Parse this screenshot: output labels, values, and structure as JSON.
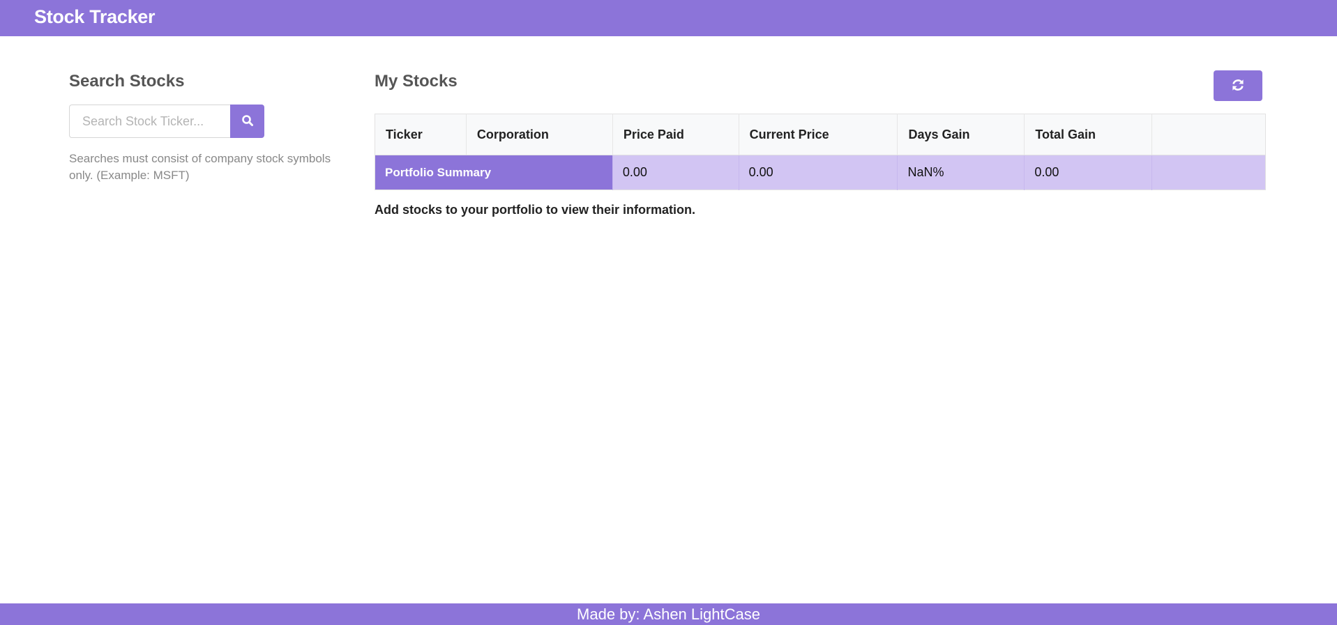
{
  "navbar": {
    "brand": "Stock Tracker"
  },
  "search": {
    "title": "Search Stocks",
    "placeholder": "Search Stock Ticker...",
    "button_icon": "search-icon",
    "help_text": "Searches must consist of company stock symbols only. (Example: MSFT)"
  },
  "portfolio": {
    "title": "My Stocks",
    "refresh_icon": "refresh-icon",
    "columns": [
      "Ticker",
      "Corporation",
      "Price Paid",
      "Current Price",
      "Days Gain",
      "Total Gain",
      ""
    ],
    "summary": {
      "label": "Portfolio Summary",
      "price_paid": "0.00",
      "current_price": "0.00",
      "days_gain": "NaN%",
      "total_gain": "0.00"
    },
    "empty_message": "Add stocks to your portfolio to view their information."
  },
  "footer": {
    "text": "Made by: Ashen LightCase"
  },
  "colors": {
    "accent": "#8c74d9",
    "accent_light": "#d2c5f3"
  }
}
